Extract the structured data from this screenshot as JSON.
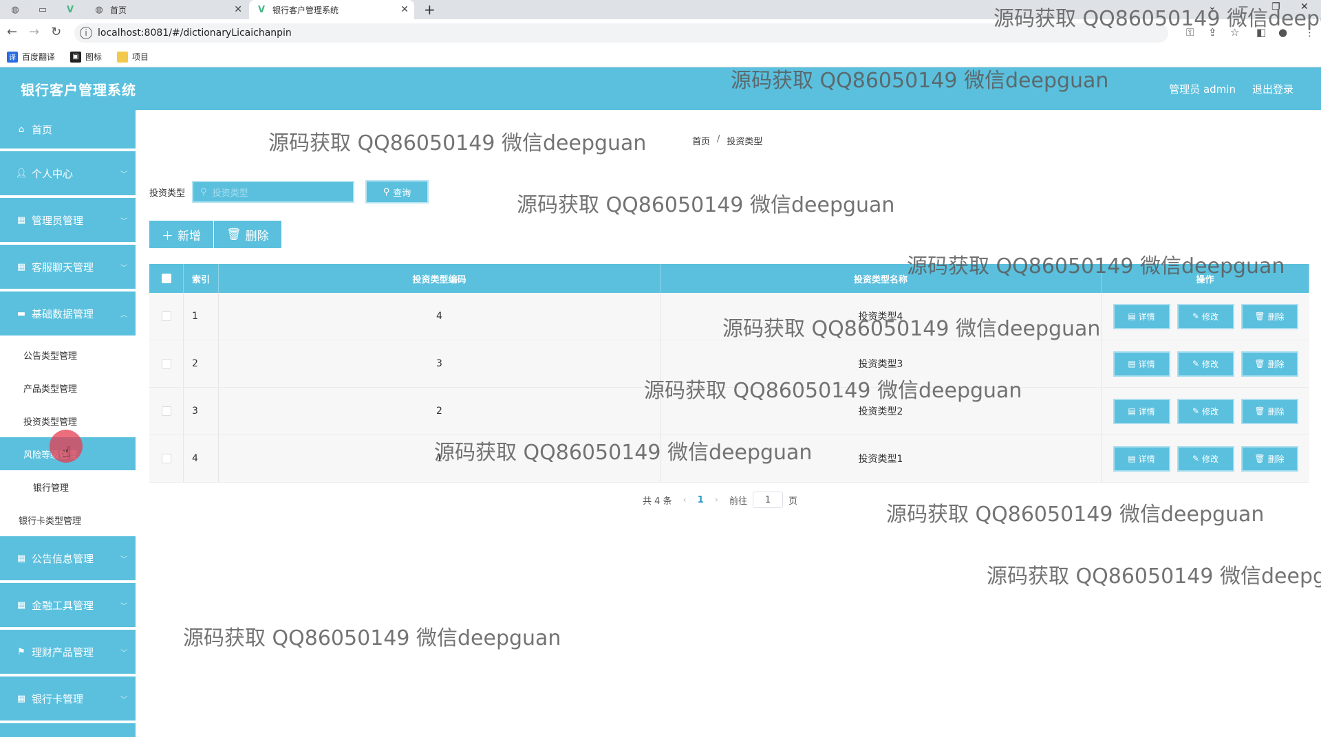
{
  "browser": {
    "tabs": [
      {
        "label": "",
        "icon": "globe-icon"
      },
      {
        "label": "",
        "icon": "blank-tab-icon"
      },
      {
        "label": "",
        "icon": "vue-icon"
      },
      {
        "label": "首页",
        "icon": "globe-icon"
      },
      {
        "label": "银行客户管理系统",
        "icon": "vue-icon"
      }
    ],
    "new_tab": "+",
    "url": "localhost:8081/#/dictionaryLicaichanpin",
    "bookmarks": [
      {
        "label": "百度翻译",
        "icon": "translate-icon"
      },
      {
        "label": "图标",
        "icon": "image-icon"
      },
      {
        "label": "项目",
        "icon": "folder-icon"
      }
    ]
  },
  "app": {
    "title": "银行客户管理系统",
    "admin_label": "管理员 admin",
    "logout_label": "退出登录"
  },
  "sidebar": {
    "items": [
      {
        "label": "首页",
        "icon": "home-icon"
      },
      {
        "label": "个人中心",
        "icon": "user-icon"
      },
      {
        "label": "管理员管理",
        "icon": "grid-icon"
      },
      {
        "label": "客服聊天管理",
        "icon": "grid-icon"
      },
      {
        "label": "基础数据管理",
        "icon": "monitor-icon"
      }
    ],
    "sub_items": [
      {
        "label": "公告类型管理"
      },
      {
        "label": "产品类型管理"
      },
      {
        "label": "投资类型管理"
      },
      {
        "label": "风险等级管理"
      },
      {
        "label": "银行管理"
      },
      {
        "label": "银行卡类型管理"
      }
    ],
    "items_after": [
      {
        "label": "公告信息管理",
        "icon": "grid-icon"
      },
      {
        "label": "金融工具管理",
        "icon": "grid-icon"
      },
      {
        "label": "理财产品管理",
        "icon": "flag-icon"
      },
      {
        "label": "银行卡管理",
        "icon": "grid-icon"
      }
    ]
  },
  "breadcrumb": {
    "home": "首页",
    "separator": "/",
    "current": "投资类型"
  },
  "search": {
    "label": "投资类型",
    "placeholder": "投资类型",
    "query_button": "查询"
  },
  "actions": {
    "add": "新增",
    "delete": "删除"
  },
  "table": {
    "headers": {
      "index": "索引",
      "code": "投资类型编码",
      "name": "投资类型名称",
      "ops": "操作"
    },
    "rows": [
      {
        "index": "1",
        "code": "4",
        "name": "投资类型4"
      },
      {
        "index": "2",
        "code": "3",
        "name": "投资类型3"
      },
      {
        "index": "3",
        "code": "2",
        "name": "投资类型2"
      },
      {
        "index": "4",
        "code": "1",
        "name": "投资类型1"
      }
    ],
    "row_buttons": {
      "detail": "详情",
      "edit": "修改",
      "delete": "删除"
    }
  },
  "pagination": {
    "total": "共 4 条",
    "current_page": "1",
    "goto_prefix": "前往",
    "goto_value": "1",
    "goto_suffix": "页"
  },
  "watermark": "源码获取 QQ86050149 微信deepguan",
  "colors": {
    "primary": "#5bc0de",
    "text": "#333333"
  }
}
